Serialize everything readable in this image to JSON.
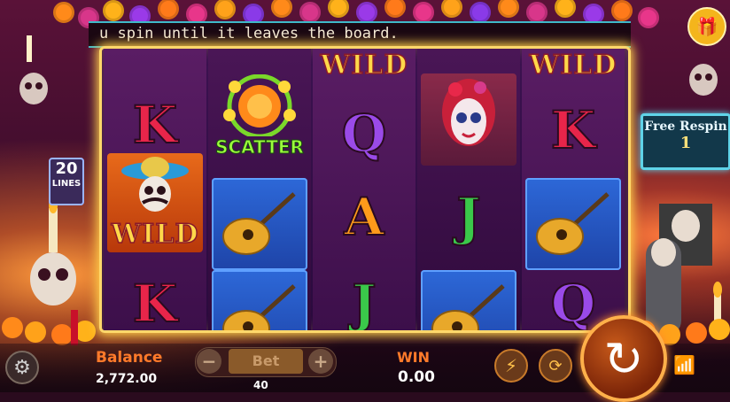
{
  "marquee": {
    "text": "u spin until it leaves the board."
  },
  "lines_badge": {
    "number": "20",
    "label": "LINES"
  },
  "free_respin": {
    "label": "Free Respin",
    "value": "1"
  },
  "reels": {
    "reel1": [
      "K",
      "WILD",
      "K"
    ],
    "reel2": [
      "SCATTER",
      "guitar",
      "guitar"
    ],
    "reel3": [
      "WILD",
      "Q",
      "A",
      "J"
    ],
    "reel4": [
      "lady",
      "J",
      "guitar"
    ],
    "reel5": [
      "WILD",
      "K",
      "guitar",
      "Q"
    ]
  },
  "symbols": {
    "wild": "WILD",
    "scatter": "SCATTER",
    "k": "K",
    "q": "Q",
    "a": "A",
    "j": "J"
  },
  "bottom_bar": {
    "balance_label": "Balance",
    "balance_value": "2,772.00",
    "bet_label": "Bet",
    "bet_value": "40",
    "bet_minus": "−",
    "bet_plus": "+",
    "win_label": "WIN",
    "win_value": "0.00"
  },
  "icons": {
    "gift": "gift-icon",
    "settings": "gear-icon",
    "turbo": "lightning-icon",
    "auto": "autoplay-icon",
    "spin": "spin-icon",
    "wifi": "wifi-icon"
  },
  "colors": {
    "frame_glow": "#ffd86b",
    "accent_orange": "#ff7a2a",
    "respin_border": "#5fd3e8",
    "scatter_green": "#9cff3c"
  }
}
